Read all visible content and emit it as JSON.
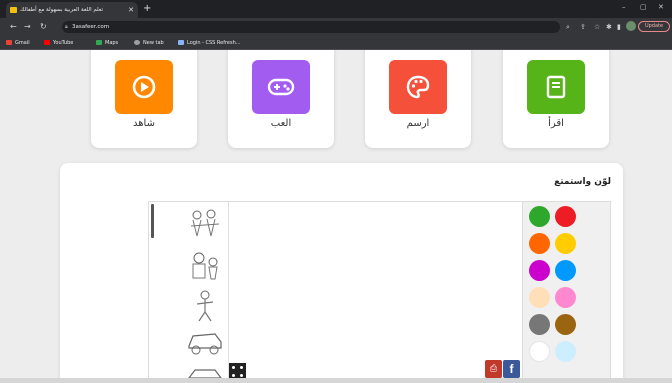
{
  "browser": {
    "tab_title": "تعلم اللغة العربية بسهولة مع أطفالك",
    "url": "3asafeer.com",
    "update_label": "Update",
    "bookmarks": [
      {
        "label": "Gmail",
        "color": "#ea4335"
      },
      {
        "label": "YouTube",
        "color": "#ff0000"
      },
      {
        "label": "Maps",
        "color": "#34a853"
      },
      {
        "label": "New tab",
        "color": "#9aa0a6"
      },
      {
        "label": "Login - CSS Refresh...",
        "color": "#8ab4f8"
      }
    ]
  },
  "activities": [
    {
      "label": "شاهد",
      "color": "#ff8800",
      "icon": "play-icon"
    },
    {
      "label": "العب",
      "color": "#a25cf0",
      "icon": "gamepad-icon"
    },
    {
      "label": "ارسم",
      "color": "#f5503a",
      "icon": "palette-icon"
    },
    {
      "label": "اقرأ",
      "color": "#57b418",
      "icon": "book-icon"
    }
  ],
  "coloring": {
    "title": "لوّن واستمتع",
    "colors": [
      "#2da82d",
      "#ee1c25",
      "#ff6600",
      "#ffcc00",
      "#cc00cc",
      "#0099ff",
      "#ffdfb8",
      "#ff88d0",
      "#777777",
      "#9a6411",
      "#ffffff",
      "#cdeeff"
    ],
    "pictures": [
      "children-drawing",
      "kids-drawing",
      "person-drawing",
      "car-drawing",
      "vehicle-drawing"
    ]
  }
}
